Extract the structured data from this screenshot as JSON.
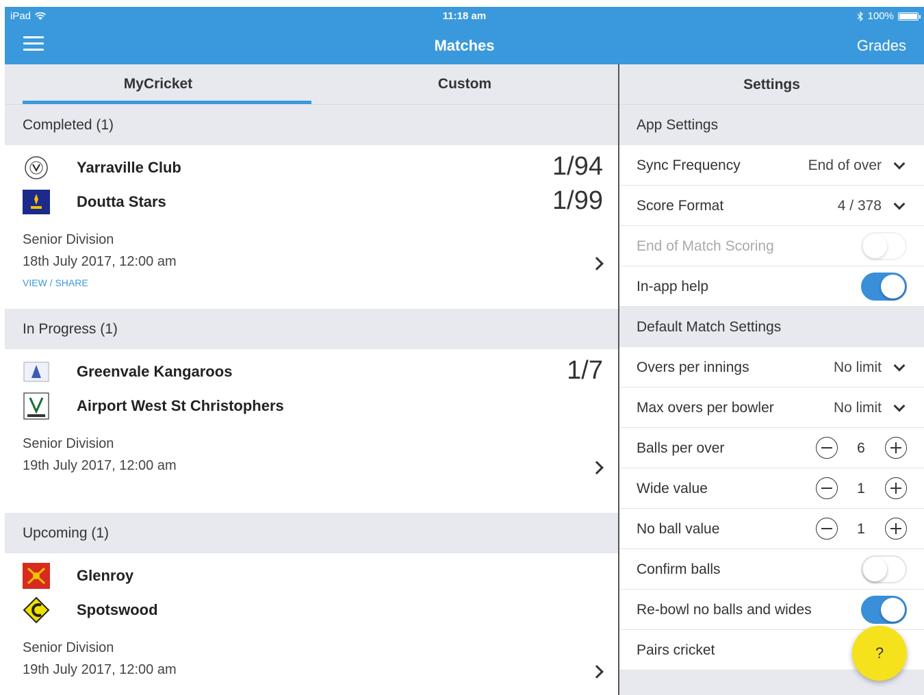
{
  "status_bar": {
    "device": "iPad",
    "time": "11:18 am",
    "battery": "100%"
  },
  "nav": {
    "title": "Matches",
    "right_button": "Grades"
  },
  "tabs": [
    {
      "label": "MyCricket"
    },
    {
      "label": "Custom"
    }
  ],
  "sections": [
    {
      "header": "Completed (1)",
      "match": {
        "team1": {
          "name": "Yarraville Club",
          "score": "1/94"
        },
        "team2": {
          "name": "Doutta Stars",
          "score": "1/99"
        },
        "division": "Senior Division",
        "date": "18th July 2017, 12:00 am",
        "link": "VIEW / SHARE"
      }
    },
    {
      "header": "In Progress (1)",
      "match": {
        "team1": {
          "name": "Greenvale Kangaroos",
          "score": "1/7"
        },
        "team2": {
          "name": "Airport West St Christophers",
          "score": ""
        },
        "division": "Senior Division",
        "date": "19th July 2017, 12:00 am"
      }
    },
    {
      "header": "Upcoming (1)",
      "match": {
        "team1": {
          "name": "Glenroy",
          "score": ""
        },
        "team2": {
          "name": "Spotswood",
          "score": ""
        },
        "division": "Senior Division",
        "date": "19th July 2017, 12:00 am"
      }
    }
  ],
  "settings": {
    "title": "Settings",
    "app_section": "App Settings",
    "sync_frequency": {
      "label": "Sync Frequency",
      "value": "End of over"
    },
    "score_format": {
      "label": "Score Format",
      "value": "4 / 378"
    },
    "end_of_match_scoring": {
      "label": "End of Match Scoring",
      "on": false,
      "enabled": false
    },
    "in_app_help": {
      "label": "In-app help",
      "on": true
    },
    "default_section": "Default Match Settings",
    "overs_per_innings": {
      "label": "Overs per innings",
      "value": "No limit"
    },
    "max_overs_per_bowler": {
      "label": "Max overs per bowler",
      "value": "No limit"
    },
    "balls_per_over": {
      "label": "Balls per over",
      "value": "6"
    },
    "wide_value": {
      "label": "Wide value",
      "value": "1"
    },
    "no_ball_value": {
      "label": "No ball value",
      "value": "1"
    },
    "confirm_balls": {
      "label": "Confirm balls",
      "on": false
    },
    "rebowl": {
      "label": "Re-bowl no balls and wides",
      "on": true
    },
    "pairs_cricket": {
      "label": "Pairs cricket"
    }
  },
  "help_button": "?",
  "colors": {
    "accent": "#3a99dc",
    "section_bg": "#e7e9ee",
    "fab": "#f6e21c"
  }
}
